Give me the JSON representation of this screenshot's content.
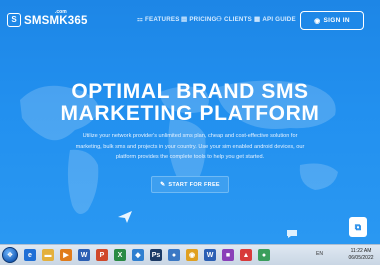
{
  "brand": {
    "name": "SMSMK365",
    "superscript": ".com",
    "mark": "S"
  },
  "nav": {
    "features": "FEATURES",
    "pricing": "PRICING",
    "clients": "CLIENTS",
    "api_guide": "API GUIDE",
    "sign_in": "SIGN IN"
  },
  "hero": {
    "title_line1": "OPTIMAL BRAND SMS",
    "title_line2": "MARKETING PLATFORM",
    "desc_line1": "Utilize your network provider's unlimited sms plan, cheap and cost-effective solution for",
    "desc_line2": "marketing, bulk sms and projects in your country. Use your sim enabled android devices, our",
    "desc_line3": "platform provides the complete tools to help you get started.",
    "cta_label": "START FOR FREE"
  },
  "taskbar": {
    "clock_time": "11:22 AM",
    "clock_date": "06/05/2022",
    "tray_text": "EN",
    "apps": [
      {
        "icon": "internet-explorer-icon",
        "glyph": "e",
        "color": "#1f6fd6"
      },
      {
        "icon": "folder-icon",
        "glyph": "▬",
        "color": "#e4b03c"
      },
      {
        "icon": "media-player-icon",
        "glyph": "▶",
        "color": "#e07b1a"
      },
      {
        "icon": "word-icon",
        "glyph": "W",
        "color": "#2b5fb4"
      },
      {
        "icon": "powerpoint-icon",
        "glyph": "P",
        "color": "#d0482a"
      },
      {
        "icon": "excel-icon",
        "glyph": "X",
        "color": "#2a8a43"
      },
      {
        "icon": "app-icon",
        "glyph": "◆",
        "color": "#2f7fd0"
      },
      {
        "icon": "photoshop-icon",
        "glyph": "Ps",
        "color": "#1b3a66"
      },
      {
        "icon": "app-icon-2",
        "glyph": "●",
        "color": "#3b78c4"
      },
      {
        "icon": "chrome-icon",
        "glyph": "◉",
        "color": "#e0a020"
      },
      {
        "icon": "word-icon-2",
        "glyph": "W",
        "color": "#2b5fb4"
      },
      {
        "icon": "app-icon-3",
        "glyph": "■",
        "color": "#8a3fb8"
      },
      {
        "icon": "app-icon-4",
        "glyph": "▲",
        "color": "#d83a3a"
      },
      {
        "icon": "app-icon-5",
        "glyph": "●",
        "color": "#3a9e5c"
      }
    ]
  },
  "colors": {
    "accent": "#1e88e8",
    "cta_bg": "#3d9ff0"
  }
}
